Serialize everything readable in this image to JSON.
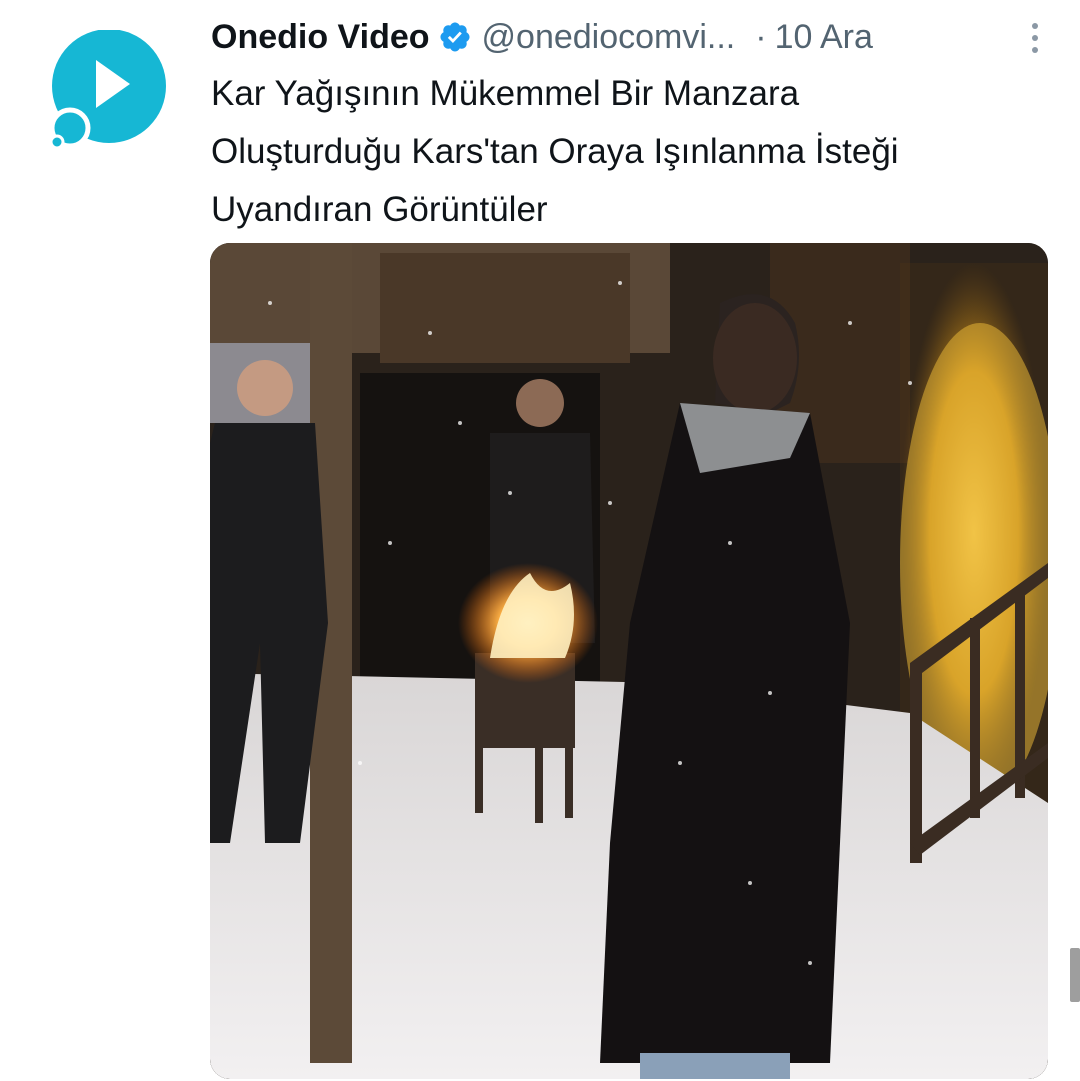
{
  "tweet": {
    "author": {
      "display_name": "Onedio Video",
      "handle": "@onediocomvi...",
      "verified": true,
      "avatar_icon": "onedio-play-logo-icon",
      "avatar_color": "#16b7d4"
    },
    "separator": "·",
    "date": "10 Ara",
    "text_lines": [
      "Kar Yağışının Mükemmel Bir Manzara",
      "Oluşturduğu Kars'tan Oraya Işınlanma İsteği",
      "Uyandıran Görüntüler"
    ],
    "media": {
      "type": "video",
      "icon": "video-thumbnail"
    }
  },
  "colors": {
    "name": "#0f1419",
    "secondary": "#536471",
    "verified": "#1d9bf0",
    "brand": "#16b7d4"
  },
  "icons": {
    "verified": "verified-badge-icon",
    "more": "more-options-icon"
  }
}
